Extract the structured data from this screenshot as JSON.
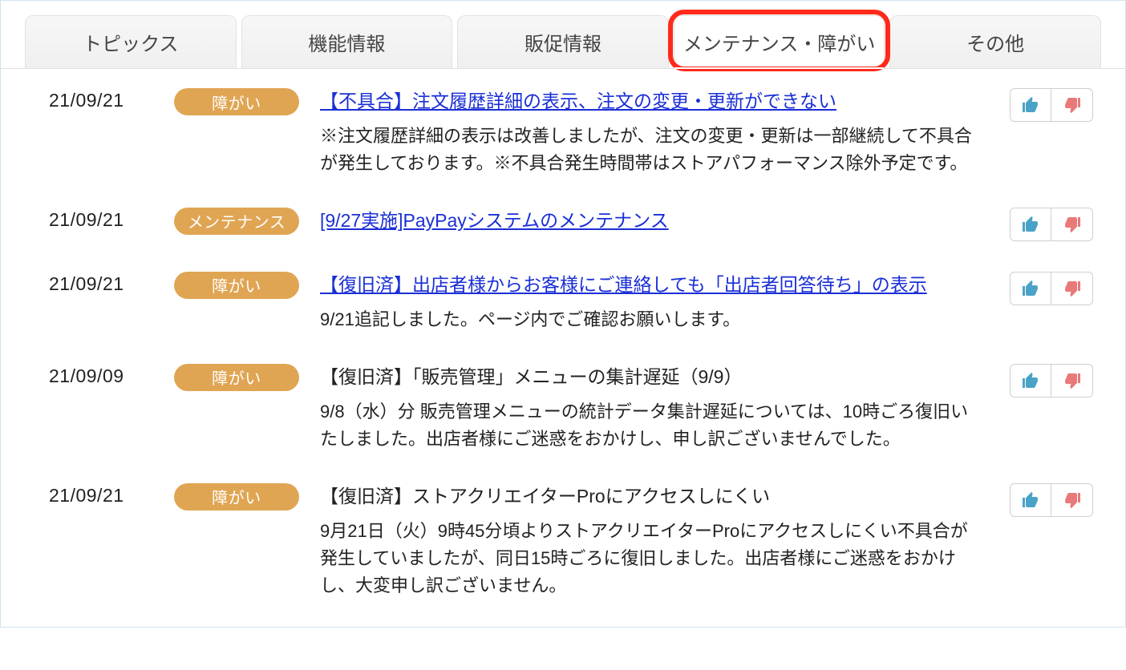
{
  "tabs": [
    {
      "label": "トピックス",
      "active": false,
      "highlight": false
    },
    {
      "label": "機能情報",
      "active": false,
      "highlight": false
    },
    {
      "label": "販促情報",
      "active": false,
      "highlight": false
    },
    {
      "label": "メンテナンス・障がい",
      "active": true,
      "highlight": true
    },
    {
      "label": "その他",
      "active": false,
      "highlight": false
    }
  ],
  "badge": {
    "issue": "障がい",
    "maintenance": "メンテナンス"
  },
  "colors": {
    "badge_bg": "#e0a553",
    "link": "#1a2fd6",
    "thumbs_up": "#4aa3c7",
    "thumbs_down": "#e87a7a",
    "highlight_border": "#ff2a1a"
  },
  "items": [
    {
      "date": "21/09/21",
      "badge_key": "issue",
      "is_link": true,
      "title": "【不具合】注文履歴詳細の表示、注文の変更・更新ができない",
      "desc": "※注文履歴詳細の表示は改善しましたが、注文の変更・更新は一部継続して不具合が発生しております。※不具合発生時間帯はストアパフォーマンス除外予定です。"
    },
    {
      "date": "21/09/21",
      "badge_key": "maintenance",
      "is_link": true,
      "title": "[9/27実施]PayPayシステムのメンテナンス",
      "desc": ""
    },
    {
      "date": "21/09/21",
      "badge_key": "issue",
      "is_link": true,
      "title": "【復旧済】出店者様からお客様にご連絡しても「出店者回答待ち」の表示",
      "desc": "9/21追記しました。ページ内でご確認お願いします。"
    },
    {
      "date": "21/09/09",
      "badge_key": "issue",
      "is_link": false,
      "title": "【復旧済】「販売管理」メニューの集計遅延（9/9）",
      "desc": "9/8（水）分 販売管理メニューの統計データ集計遅延については、10時ごろ復旧いたしました。出店者様にご迷惑をおかけし、申し訳ございませんでした。"
    },
    {
      "date": "21/09/21",
      "badge_key": "issue",
      "is_link": false,
      "title": "【復旧済】ストアクリエイターProにアクセスしにくい",
      "desc": "9月21日（火）9時45分頃よりストアクリエイターProにアクセスしにくい不具合が発生していましたが、同日15時ごろに復旧しました。出店者様にご迷惑をおかけし、大変申し訳ございません。"
    }
  ]
}
